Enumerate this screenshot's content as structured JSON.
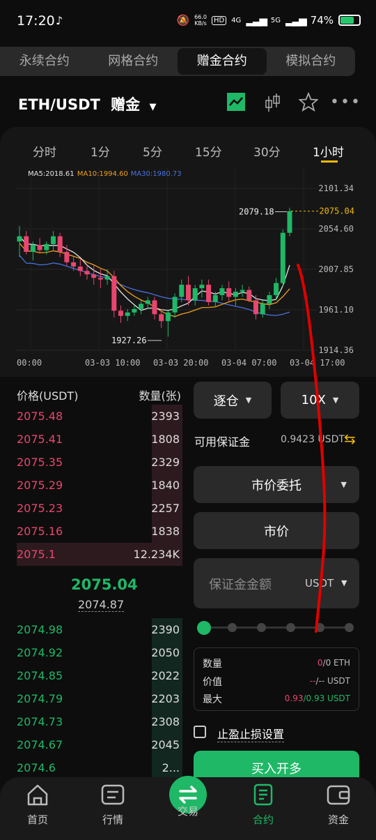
{
  "status_bar": {
    "time": "17:20",
    "net_speed": "66.0",
    "net_unit": "KB/s",
    "signal1": "4G",
    "signal2": "5G",
    "battery": "74%",
    "battery_level": 0.74
  },
  "tabs": [
    "永续合约",
    "网格合约",
    "赠金合约",
    "模拟合约"
  ],
  "active_tab": 2,
  "pair": {
    "symbol": "ETH/USDT",
    "mode": "赠金"
  },
  "timeframes": [
    "分时",
    "1分",
    "5分",
    "15分",
    "30分",
    "1小时"
  ],
  "active_timeframe": 5,
  "chart_data": {
    "type": "candlestick",
    "indicators": [
      {
        "name": "MA5",
        "value": "MA5:2018.61",
        "color": "#e6e6e6"
      },
      {
        "name": "MA10",
        "value": "MA10:1994.60",
        "color": "#f0a020"
      },
      {
        "name": "MA30",
        "value": "MA30:1980.73",
        "color": "#4a70e0"
      }
    ],
    "y_ticks": [
      "2101.34",
      "2054.60",
      "2007.85",
      "1961.10",
      "1914.36"
    ],
    "ylim": [
      1914.36,
      2101.34
    ],
    "x_ticks": [
      "00:00",
      "03-03 10:00",
      "03-03 20:00",
      "03-04 07:00",
      "03-04 17:00"
    ],
    "high_label": "2079.18",
    "low_label": "1927.26",
    "last_price_label": "2075.04",
    "colors": {
      "up": "#1fb866",
      "down": "#e8466e",
      "ma5": "#e6e6e6",
      "ma10": "#f0a020",
      "ma30": "#4a70e0",
      "last": "#f0b90b"
    },
    "candles": [
      [
        2040,
        2058,
        2022,
        2046
      ],
      [
        2046,
        2052,
        2025,
        2028
      ],
      [
        2028,
        2040,
        2018,
        2036
      ],
      [
        2036,
        2044,
        2026,
        2030
      ],
      [
        2030,
        2040,
        2025,
        2037
      ],
      [
        2037,
        2052,
        2030,
        2046
      ],
      [
        2046,
        2050,
        2022,
        2028
      ],
      [
        2028,
        2036,
        2012,
        2016
      ],
      [
        2016,
        2022,
        2006,
        2011
      ],
      [
        2011,
        2020,
        2000,
        2006
      ],
      [
        2006,
        2014,
        1996,
        2002
      ],
      [
        2002,
        2012,
        1990,
        1998
      ],
      [
        1998,
        2008,
        1986,
        1996
      ],
      [
        1996,
        2008,
        1990,
        2000
      ],
      [
        2000,
        2006,
        1952,
        1960
      ],
      [
        1960,
        1966,
        1946,
        1954
      ],
      [
        1954,
        1962,
        1948,
        1958
      ],
      [
        1958,
        1966,
        1954,
        1962
      ],
      [
        1962,
        1972,
        1956,
        1968
      ],
      [
        1968,
        1976,
        1962,
        1972
      ],
      [
        1972,
        1976,
        1950,
        1956
      ],
      [
        1956,
        1962,
        1940,
        1948
      ],
      [
        1948,
        1960,
        1930,
        1958
      ],
      [
        1958,
        1980,
        1952,
        1976
      ],
      [
        1976,
        1996,
        1970,
        1990
      ],
      [
        1990,
        2000,
        1966,
        1972
      ],
      [
        1972,
        1990,
        1966,
        1986
      ],
      [
        1986,
        1996,
        1975,
        1990
      ],
      [
        1990,
        1996,
        1966,
        1970
      ],
      [
        1970,
        1982,
        1964,
        1978
      ],
      [
        1978,
        1990,
        1972,
        1986
      ],
      [
        1986,
        1994,
        1970,
        1976
      ],
      [
        1976,
        1986,
        1966,
        1982
      ],
      [
        1982,
        1990,
        1976,
        1984
      ],
      [
        1984,
        1988,
        1970,
        1972
      ],
      [
        1972,
        1978,
        1950,
        1956
      ],
      [
        1956,
        1972,
        1952,
        1968
      ],
      [
        1968,
        1982,
        1962,
        1978
      ],
      [
        1978,
        1998,
        1972,
        1992
      ],
      [
        1992,
        2054,
        1988,
        2050
      ],
      [
        2050,
        2079,
        2046,
        2075
      ]
    ]
  },
  "orderbook": {
    "head_price": "价格(USDT)",
    "head_qty": "数量(张)",
    "asks": [
      {
        "p": "2075.48",
        "q": "2393",
        "d": 0.18
      },
      {
        "p": "2075.41",
        "q": "1808",
        "d": 0.14
      },
      {
        "p": "2075.35",
        "q": "2329",
        "d": 0.18
      },
      {
        "p": "2075.29",
        "q": "1840",
        "d": 0.14
      },
      {
        "p": "2075.23",
        "q": "2257",
        "d": 0.17
      },
      {
        "p": "2075.16",
        "q": "1838",
        "d": 0.14
      },
      {
        "p": "2075.1",
        "q": "12.234K",
        "d": 1.0
      }
    ],
    "mid": "2075.04",
    "mark": "2074.87",
    "bids": [
      {
        "p": "2074.98",
        "q": "2390",
        "d": 0.18
      },
      {
        "p": "2074.92",
        "q": "2050",
        "d": 0.16
      },
      {
        "p": "2074.85",
        "q": "2022",
        "d": 0.16
      },
      {
        "p": "2074.79",
        "q": "2203",
        "d": 0.17
      },
      {
        "p": "2074.73",
        "q": "2308",
        "d": 0.18
      },
      {
        "p": "2074.67",
        "q": "2045",
        "d": 0.16
      },
      {
        "p": "2074.6",
        "q": "2...",
        "d": 0.16
      }
    ]
  },
  "form": {
    "margin_mode": "逐仓",
    "leverage": "10X",
    "avail_label": "可用保证金",
    "avail_value": "0.9423 USDT",
    "order_type": "市价委托",
    "price_field": "市价",
    "amount_placeholder": "保证金金额",
    "amount_unit": "USDT",
    "info": [
      {
        "label": "数量",
        "v1": "0",
        "v2": "/0 ETH"
      },
      {
        "label": "价值",
        "v1": "--",
        "v2": "/-- USDT"
      },
      {
        "label": "最大",
        "v1": "0.93",
        "v2": "/0.93 USDT"
      }
    ],
    "tpsl": "止盈止损设置",
    "buy": "买入开多"
  },
  "nav": [
    "首页",
    "行情",
    "交易",
    "合约",
    "资金"
  ],
  "active_nav": 3
}
